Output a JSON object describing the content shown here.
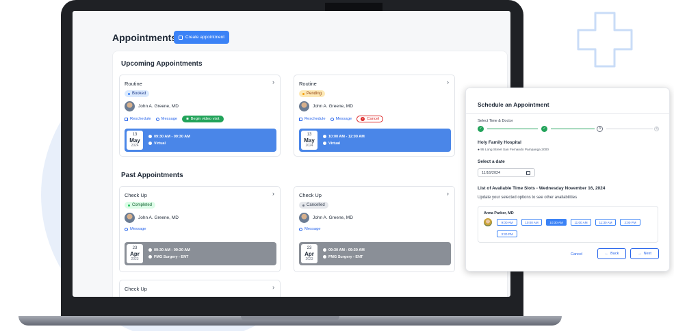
{
  "page": {
    "title": "Appointments",
    "create_button": "Create appointment"
  },
  "upcoming": {
    "title": "Upcoming Appointments",
    "cards": [
      {
        "type": "Routine",
        "status": "Booked",
        "doctor": "John A. Greene, MD",
        "actions": {
          "reschedule": "Reschedule",
          "message": "Message",
          "extra": "Begin video visit"
        },
        "date": {
          "day": "13",
          "month": "May",
          "year": "2024"
        },
        "time": "09:30 AM - 09:30 AM",
        "location": "Virtual"
      },
      {
        "type": "Routine",
        "status": "Pending",
        "doctor": "John A. Greene, MD",
        "actions": {
          "reschedule": "Reschedule",
          "message": "Message",
          "extra": "Cancel"
        },
        "date": {
          "day": "13",
          "month": "May",
          "year": "2024"
        },
        "time": "10:00 AM - 12:00 AM",
        "location": "Virtual"
      }
    ]
  },
  "past": {
    "title": "Past Appointments",
    "cards": [
      {
        "type": "Check Up",
        "status": "Completed",
        "doctor": "John A. Greene, MD",
        "actions": {
          "message": "Message"
        },
        "date": {
          "day": "23",
          "month": "Apr",
          "year": "2023"
        },
        "time": "09:30 AM - 09:30 AM",
        "location": "FMG Surgery - ENT"
      },
      {
        "type": "Check Up",
        "status": "Cancelled",
        "doctor": "John A. Greene, MD",
        "actions": {
          "message": "Message"
        },
        "date": {
          "day": "23",
          "month": "Apr",
          "year": "2023"
        },
        "time": "09:30 AM - 09:30 AM",
        "location": "FMG Surgery - ENT"
      },
      {
        "type": "Check Up"
      }
    ]
  },
  "modal": {
    "title": "Schedule an Appointment",
    "step_label": "Select Time & Doctor",
    "steps": [
      "",
      "",
      "3",
      "4"
    ],
    "hospital": "Holy Family Hospital",
    "address": "95 Long Street San Fernando Pampanga 2000",
    "select_date_label": "Select a date",
    "date_value": "11/16/2024",
    "slots_title": "List of Available Time Slots - Wednesday November 16, 2024",
    "slots_subtitle": "Update your selected options to see other availabilities",
    "doctor": "Anna Parker, MD",
    "slots": [
      "9:00 AM",
      "10:00 AM",
      "10:30 AM",
      "11:00 AM",
      "11:30 AM",
      "2:00 PM",
      "3:30 PM"
    ],
    "selected_slot": "10:30 AM",
    "cancel_label": "Cancel",
    "back_label": "Back",
    "next_label": "Next"
  },
  "colors": {
    "primary": "#3b82f6",
    "success": "#22a35a",
    "danger": "#dc2626",
    "neutral": "#8a8f97"
  }
}
